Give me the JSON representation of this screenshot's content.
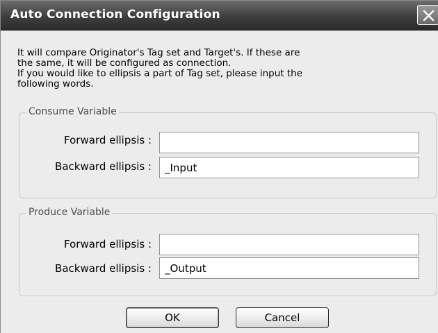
{
  "window": {
    "title": "Auto Connection Configuration",
    "close_icon": "close-icon"
  },
  "description": {
    "lines": [
      "It will compare Originator's Tag set and Target's. If these are",
      "the same, it will be configured as connection.",
      "If you would like to ellipsis a part of Tag set, please input the",
      "following words."
    ]
  },
  "consume": {
    "legend": "Consume Variable",
    "forward_label": "Forward ellipsis :",
    "forward_value": "",
    "backward_label": "Backward ellipsis :",
    "backward_value": "_Input"
  },
  "produce": {
    "legend": "Produce Variable",
    "forward_label": "Forward ellipsis :",
    "forward_value": "",
    "backward_label": "Backward ellipsis :",
    "backward_value": "_Output"
  },
  "buttons": {
    "ok": "OK",
    "cancel": "Cancel"
  }
}
